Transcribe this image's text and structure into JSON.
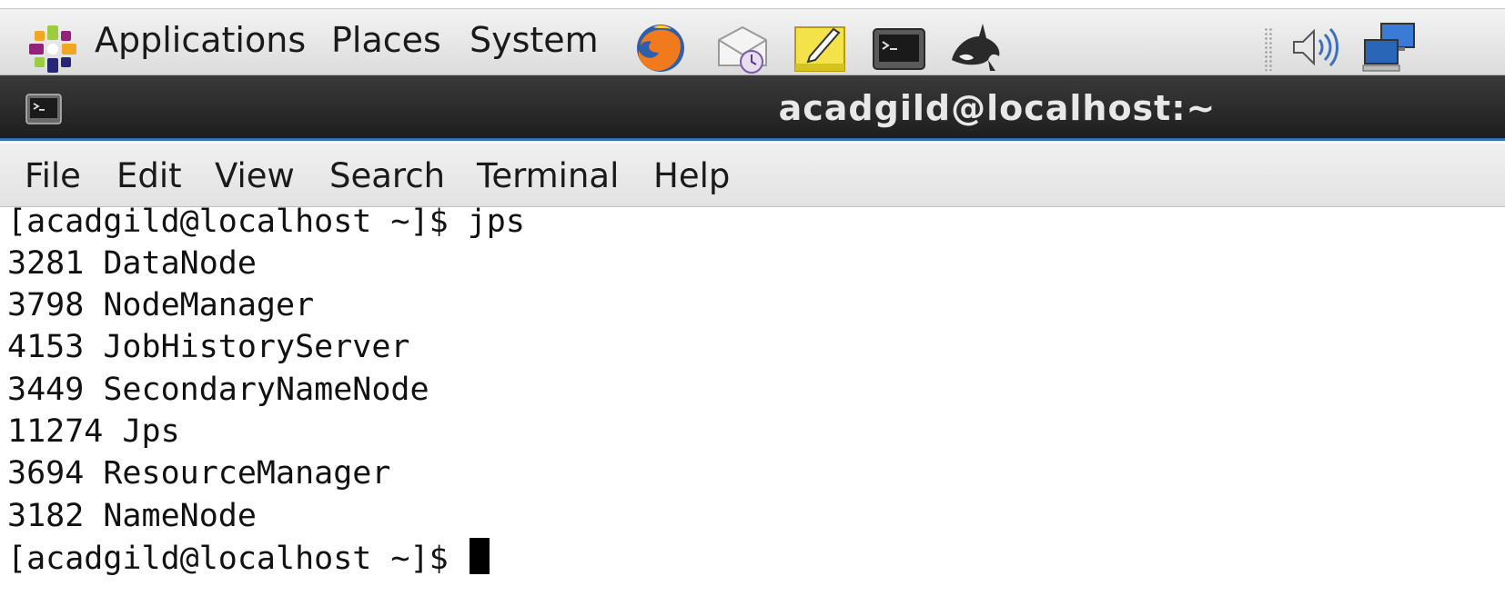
{
  "panel": {
    "menu": [
      "Applications",
      "Places",
      "System"
    ],
    "launchers": [
      "firefox-icon",
      "mail-clock-icon",
      "text-editor-icon",
      "terminal-icon",
      "orca-whale-icon"
    ],
    "tray": [
      "speaker-volume-icon",
      "network-computers-icon"
    ]
  },
  "window": {
    "title": "acadgild@localhost:~"
  },
  "menubar": [
    "File",
    "Edit",
    "View",
    "Search",
    "Terminal",
    "Help"
  ],
  "terminal": {
    "lines": [
      "[acadgild@localhost ~]$ jps",
      "3281 DataNode",
      "3798 NodeManager",
      "4153 JobHistoryServer",
      "3449 SecondaryNameNode",
      "11274 Jps",
      "3694 ResourceManager",
      "3182 NameNode"
    ],
    "prompt": "[acadgild@localhost ~]$ "
  },
  "colors": {
    "titlebar": "#262626",
    "title_accent": "#2f6fb8",
    "terminal_bg": "#ffffff",
    "terminal_fg": "#111111"
  }
}
